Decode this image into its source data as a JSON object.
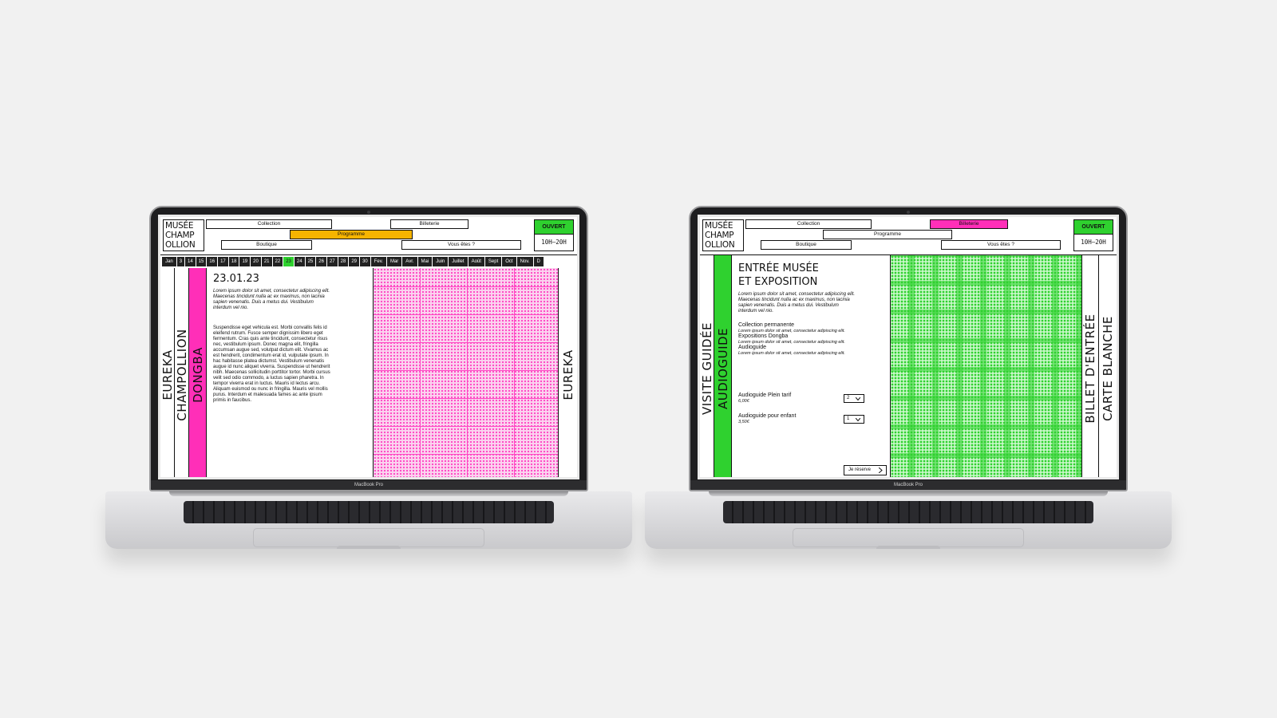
{
  "left": {
    "logo": [
      "MUSÉE",
      "CHAMP",
      "OLLION"
    ],
    "nav": {
      "collection": "Collection",
      "billetterie": "Billeterie",
      "programme": "Programme",
      "boutique": "Boutique",
      "vous_etes": "Vous êtes ?"
    },
    "status": {
      "open": "OUVERT",
      "hours": "10H–20H"
    },
    "dates": [
      "Jan",
      "3",
      "14",
      "15",
      "16",
      "17",
      "18",
      "19",
      "20",
      "21",
      "22",
      "23",
      "24",
      "25",
      "26",
      "27",
      "28",
      "29",
      "30",
      "Fev.",
      "Mar",
      "Avr.",
      "Mai",
      "Juin",
      "Juillet",
      "Août",
      "Sept",
      "Oct",
      "Nov.",
      "D"
    ],
    "columns": {
      "col1": "EUREKA",
      "col2": "CHAMPOLLION",
      "col3": "DONGBA",
      "col4": "EUREKA"
    },
    "date_heading": "23.01.23",
    "intro": "Lorem ipsum dolor sit amet, consectetur adipiscing elit. Maecenas tincidunt nulla ac ex maximus, non lacinia sapien venenatis. Duis a metus dui. Vestibulum interdum vel nio.",
    "paragraph": "Suspendisse eget vehicula est. Morbi convallis felis id eleifend rutrum. Fusce semper dignissim libero eget fermentum. Cras quis ante tincidunt, consectetur risus nec, vestibulum ipsum. Donec magna elit, fringilla accumsan augue sed, volutpat dictum elit. Vivamus ac est hendrerit, condimentum erat id, vulputate ipsum. In hac habitasse platea dictumst. Vestibulum venenatis augue id nunc aliquet viverra. Suspendisse ut hendrerit nibh. Maecenas sollicitudin porttitor tortor. Morbi cursus velit sed odio commodo, a luctus sapien pharetra. In tempor viverra erat in luctus. Mauris id lectus arcu. Aliquam euismod ou nunc in fringilla. Mauris vel mollis purus. Interdum et malesuada fames ac ante ipsum primis in faucibus."
  },
  "right": {
    "logo": [
      "MUSÉE",
      "CHAMP",
      "OLLION"
    ],
    "nav": {
      "collection": "Collection",
      "billetterie": "Billeterie",
      "programme": "Programme",
      "boutique": "Boutique",
      "vous_etes": "Vous êtes ?"
    },
    "status": {
      "open": "OUVERT",
      "hours": "10H–20H"
    },
    "columns": {
      "col1": "VISITE GUIDÉE",
      "col2": "AUDIOGUIDE",
      "col3": "BILLET D'ENTRÉE",
      "col4": "CARTE BLANCHE"
    },
    "title_line1": "ENTRÉE MUSÉE",
    "title_line2": "ET EXPOSITION",
    "intro": "Lorem ipsum dolor sit amet, consectetur adipiscing elit. Maecenas tincidunt nulla ac ex maximus, non lacinia sapien venenatis. Duis a metus dui. Vestibulum interdum vel nio.",
    "items": [
      {
        "label": "Collection permanente",
        "desc": "Lorem ipsum dolor sit amet, consectetur adipiscing elit."
      },
      {
        "label": "Expositions Dongba",
        "desc": "Lorem ipsum dolor sit amet, consectetur adipiscing elit."
      },
      {
        "label": "Audioguide",
        "desc": "Lorem ipsum dolor sit amet, consectetur adipiscing elit."
      }
    ],
    "tickets": [
      {
        "label": "Audioguide Plein tarif",
        "price": "6,00€",
        "qty": "2"
      },
      {
        "label": "Audioguide pour enfant",
        "price": "3,50€",
        "qty": "1"
      }
    ],
    "reserve": "Je réserve"
  },
  "laptop_label": "MacBook Pro",
  "colors": {
    "pink": "#ff2fb8",
    "green": "#2fd12f",
    "yellow": "#f6b400"
  },
  "icons": {
    "select": "chevron-down-icon",
    "reserve": "chevron-right-icon"
  }
}
